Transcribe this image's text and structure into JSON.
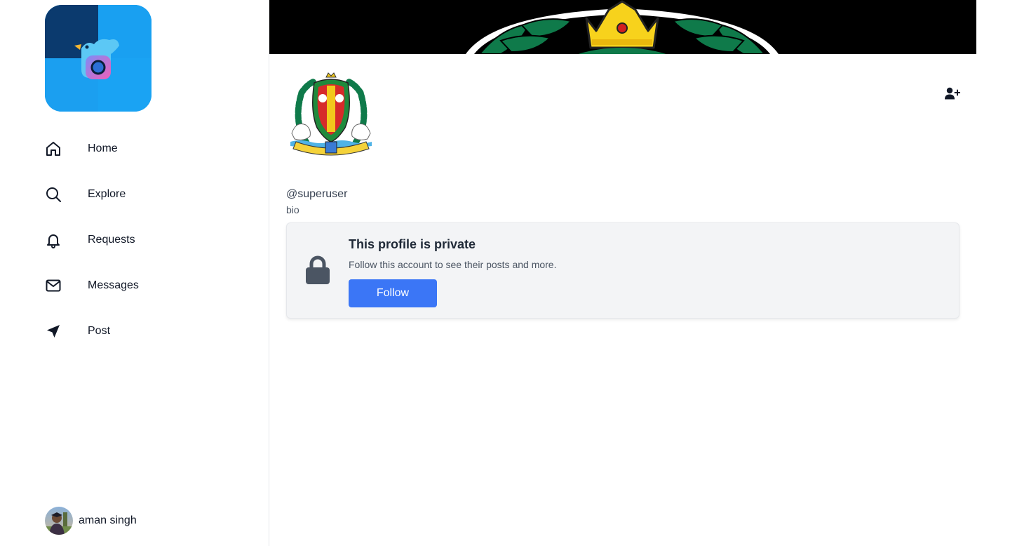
{
  "colors": {
    "accent": "#3b76f6",
    "logo_blue": "#1aa3f3",
    "banner_bg": "#000000",
    "card_bg": "#f3f4f6"
  },
  "sidebar": {
    "logo": {
      "icon": "bird-camera-logo"
    },
    "items": [
      {
        "label": "Home",
        "icon": "home-icon"
      },
      {
        "label": "Explore",
        "icon": "search-icon"
      },
      {
        "label": "Requests",
        "icon": "bell-icon"
      },
      {
        "label": "Messages",
        "icon": "mail-icon"
      },
      {
        "label": "Post",
        "icon": "send-arrow-icon"
      }
    ],
    "user": {
      "name": "aman singh",
      "icon": "user-avatar"
    }
  },
  "profile": {
    "banner_icon": "crown-emblem-banner",
    "avatar_icon": "emblem-logo",
    "add_friend_icon": "user-plus-icon",
    "handle": "@superuser",
    "bio": "bio"
  },
  "private_notice": {
    "icon": "lock-icon",
    "title": "This profile is private",
    "text": "Follow this account to see their posts and more.",
    "follow_label": "Follow"
  }
}
